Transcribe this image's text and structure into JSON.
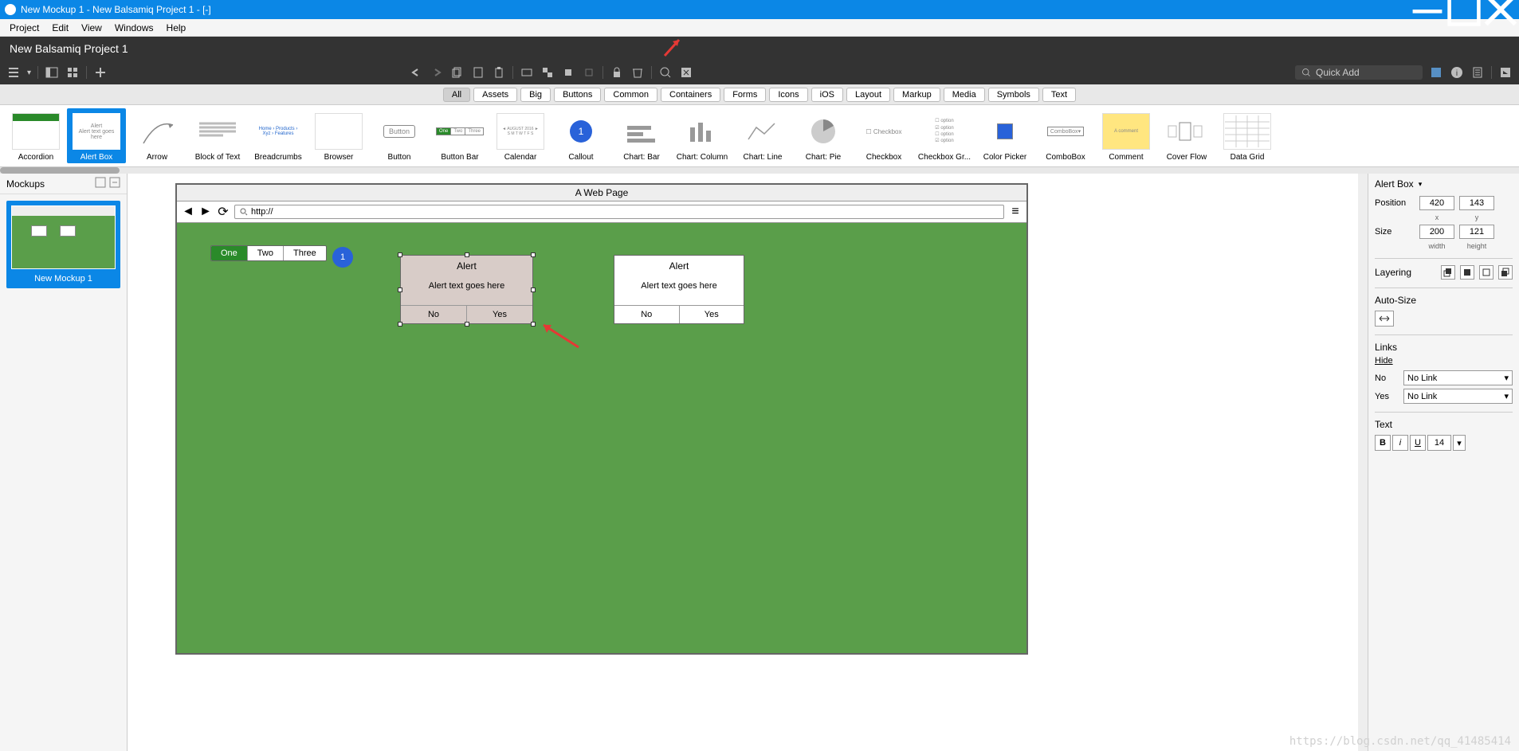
{
  "titlebar": {
    "title": "New Mockup 1 - New Balsamiq Project 1 - [-]"
  },
  "menubar": {
    "items": [
      "Project",
      "Edit",
      "View",
      "Windows",
      "Help"
    ]
  },
  "toolbar": {
    "project_name": "New Balsamiq Project 1",
    "quick_add_placeholder": "Quick Add"
  },
  "categories": [
    "All",
    "Assets",
    "Big",
    "Buttons",
    "Common",
    "Containers",
    "Forms",
    "Icons",
    "iOS",
    "Layout",
    "Markup",
    "Media",
    "Symbols",
    "Text"
  ],
  "library": [
    {
      "label": "Accordion"
    },
    {
      "label": "Alert Box"
    },
    {
      "label": "Arrow"
    },
    {
      "label": "Block of Text"
    },
    {
      "label": "Breadcrumbs"
    },
    {
      "label": "Browser"
    },
    {
      "label": "Button"
    },
    {
      "label": "Button Bar"
    },
    {
      "label": "Calendar"
    },
    {
      "label": "Callout"
    },
    {
      "label": "Chart: Bar"
    },
    {
      "label": "Chart: Column"
    },
    {
      "label": "Chart: Line"
    },
    {
      "label": "Chart: Pie"
    },
    {
      "label": "Checkbox"
    },
    {
      "label": "Checkbox Gr..."
    },
    {
      "label": "Color Picker"
    },
    {
      "label": "ComboBox"
    },
    {
      "label": "Comment"
    },
    {
      "label": "Cover Flow"
    },
    {
      "label": "Data Grid"
    }
  ],
  "mockups": {
    "header": "Mockups",
    "items": [
      {
        "label": "New Mockup 1"
      }
    ]
  },
  "canvas": {
    "browser_title": "A Web Page",
    "url_prefix": "http://",
    "tabs": [
      "One",
      "Two",
      "Three"
    ],
    "callout_text": "1",
    "alert1": {
      "title": "Alert",
      "text": "Alert text goes here",
      "no": "No",
      "yes": "Yes"
    },
    "alert2": {
      "title": "Alert",
      "text": "Alert text goes here",
      "no": "No",
      "yes": "Yes"
    }
  },
  "props": {
    "component": "Alert Box",
    "position_label": "Position",
    "x": "420",
    "y": "143",
    "x_label": "x",
    "y_label": "y",
    "size_label": "Size",
    "w": "200",
    "h": "121",
    "w_label": "width",
    "h_label": "height",
    "layering_label": "Layering",
    "autosize_label": "Auto-Size",
    "links_label": "Links",
    "hide_label": "Hide",
    "link_no_label": "No",
    "link_no_value": "No Link",
    "link_yes_label": "Yes",
    "link_yes_value": "No Link",
    "text_label": "Text",
    "font_size": "14"
  },
  "watermark": "https://blog.csdn.net/qq_41485414"
}
